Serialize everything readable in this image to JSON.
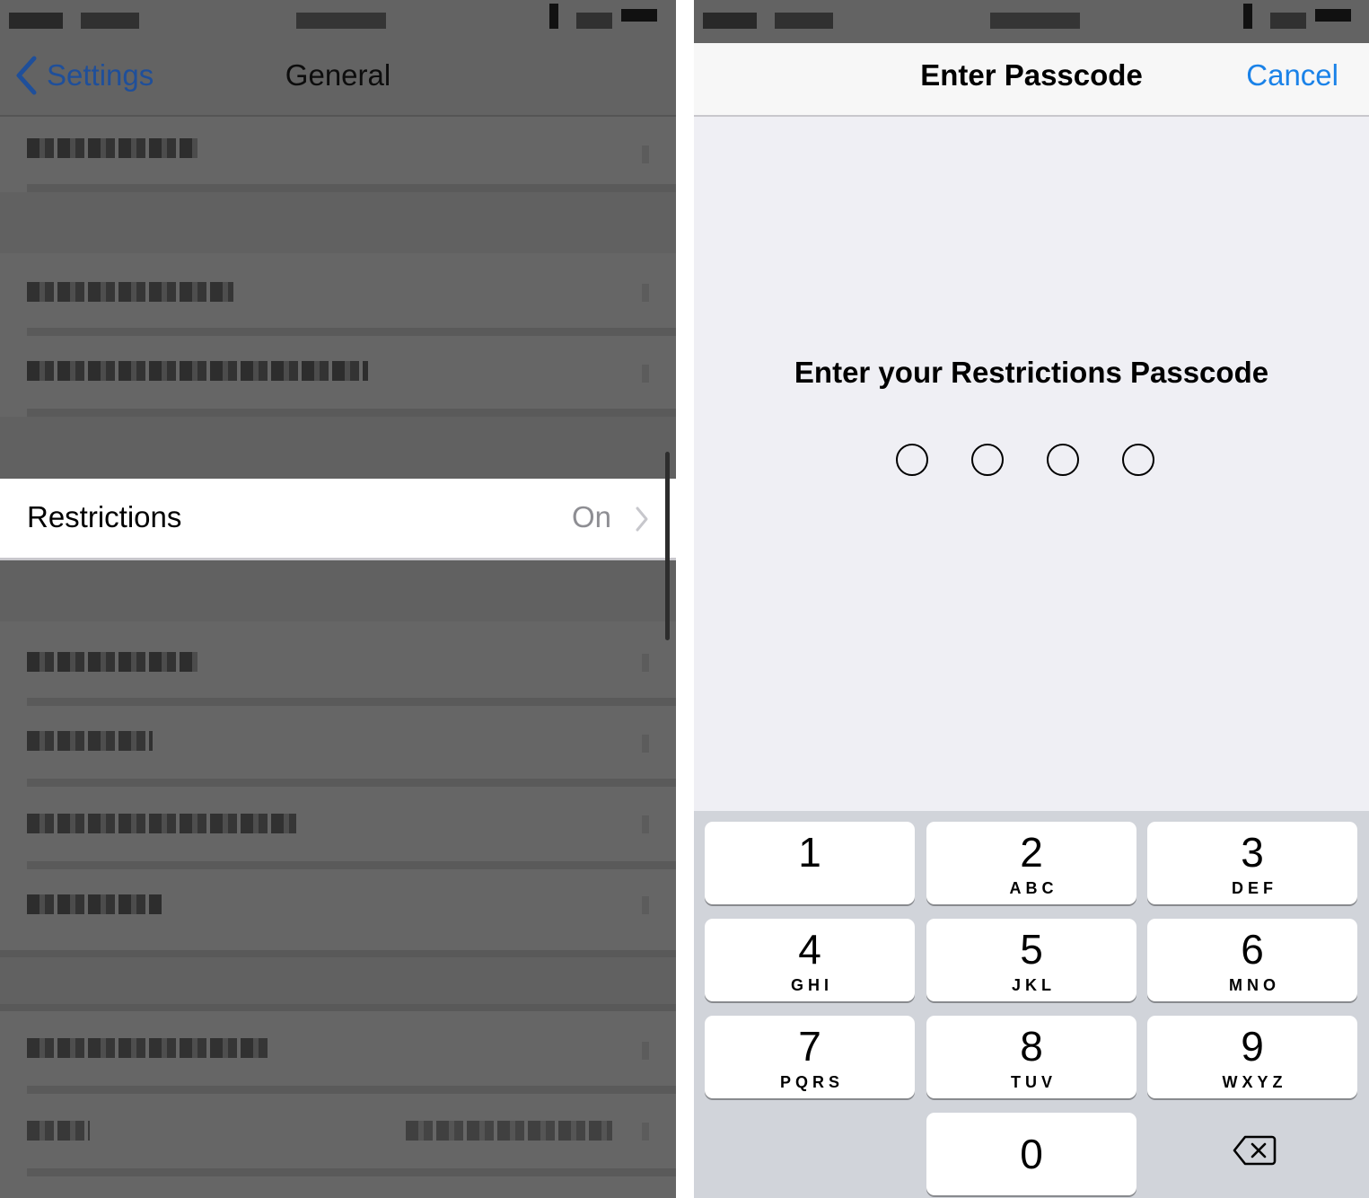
{
  "left_screen": {
    "nav": {
      "back_label": "Settings",
      "title": "General"
    },
    "restrictions_row": {
      "label": "Restrictions",
      "value": "On"
    },
    "redacted_rows_count": 10
  },
  "right_screen": {
    "nav": {
      "title": "Enter Passcode",
      "cancel_label": "Cancel"
    },
    "prompt": "Enter your Restrictions Passcode",
    "passcode_length": 4,
    "digits_entered": 0,
    "keypad": [
      {
        "num": "1",
        "letters": ""
      },
      {
        "num": "2",
        "letters": "ABC"
      },
      {
        "num": "3",
        "letters": "DEF"
      },
      {
        "num": "4",
        "letters": "GHI"
      },
      {
        "num": "5",
        "letters": "JKL"
      },
      {
        "num": "6",
        "letters": "MNO"
      },
      {
        "num": "7",
        "letters": "PQRS"
      },
      {
        "num": "8",
        "letters": "TUV"
      },
      {
        "num": "9",
        "letters": "WXYZ"
      },
      {
        "num": "0",
        "letters": ""
      }
    ],
    "delete_icon": "delete-backspace-icon"
  },
  "colors": {
    "ios_blue": "#1a82e8",
    "dim_overlay": "#636363",
    "keypad_bg": "#d1d4da"
  }
}
